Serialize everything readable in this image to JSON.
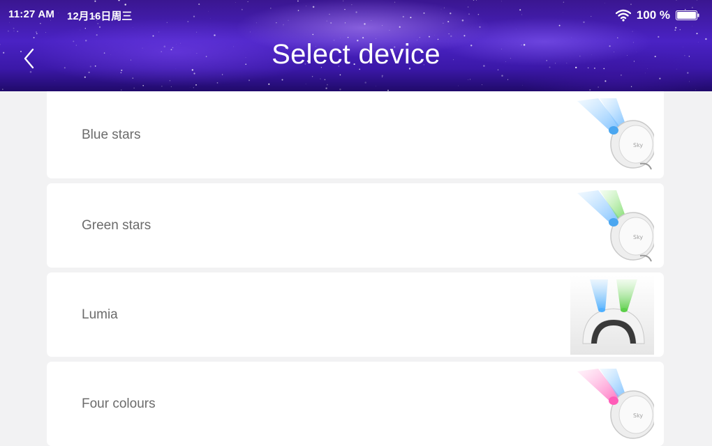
{
  "status_bar": {
    "time": "11:27 AM",
    "date": "12月16日周三",
    "battery": "100 %"
  },
  "header": {
    "title": "Select device",
    "back_icon": "chevron-left-icon"
  },
  "devices": [
    {
      "label": "Blue stars",
      "image": "star-projector-blue-image"
    },
    {
      "label": "Green stars",
      "image": "star-projector-green-image"
    },
    {
      "label": "Lumia",
      "image": "lumia-projector-image"
    },
    {
      "label": "Four colours",
      "image": "star-projector-four-colours-image"
    }
  ],
  "colors": {
    "header_purple": "#4a22c4",
    "background": "#f2f2f3",
    "card": "#ffffff",
    "label_text": "#6b6b6b"
  }
}
